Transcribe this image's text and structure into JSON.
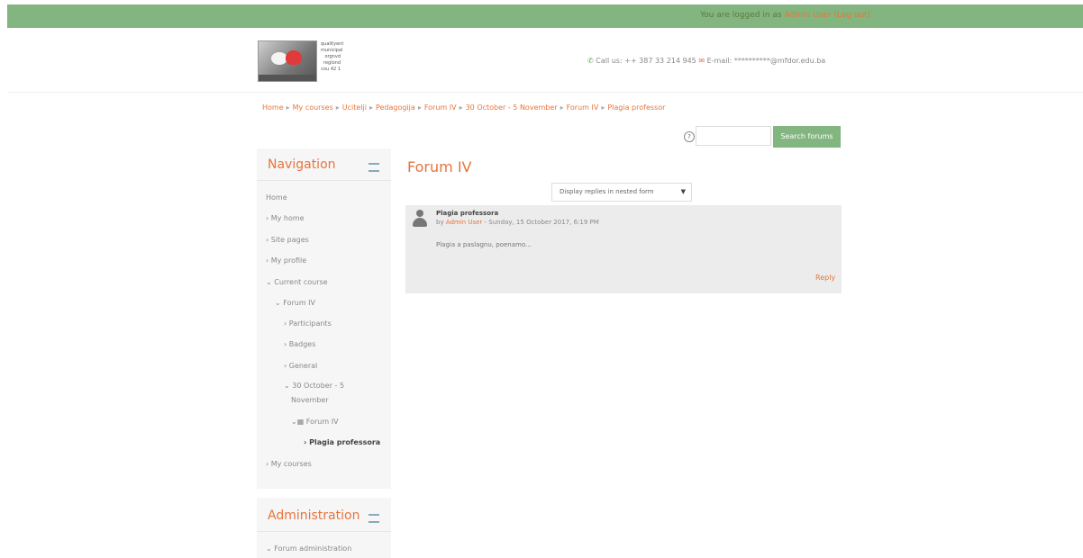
{
  "topbar": {
    "login_prefix": "You are logged in as ",
    "login_link": "Admin User (Log out)"
  },
  "header": {
    "logo_text": [
      "qualityent",
      "municipal",
      "orgnvd",
      "reglond",
      "cou 42 1"
    ],
    "call_label": "Call us: ++ 387 33 214 945",
    "email_label": "E-mail: **********@mfdor.edu.ba"
  },
  "breadcrumb": [
    "Home",
    "My courses",
    "Ucitelji",
    "Pedagogija",
    "Forum IV",
    "30 October - 5 November",
    "Forum IV",
    "Plagia professor"
  ],
  "search": {
    "placeholder": "",
    "button_label": "Search forums",
    "help_glyph": "?"
  },
  "nav_block": {
    "title": "Navigation",
    "items": [
      {
        "label": "Home",
        "active": false
      },
      {
        "label": "› My home",
        "active": false
      },
      {
        "label": "› Site pages",
        "active": false
      },
      {
        "label": "› My profile",
        "active": false
      },
      {
        "label": "⌄ Current course",
        "active": false
      },
      {
        "label": "⌄ Forum IV",
        "active": false
      },
      {
        "label": "› Participants",
        "active": false
      },
      {
        "label": "› Badges",
        "active": false
      },
      {
        "label": "› General",
        "active": false
      },
      {
        "label": "⌄ 30 October - 5",
        "active": false
      },
      {
        "label": "November",
        "active": false
      },
      {
        "label": "⌄▦ Forum IV",
        "active": false
      },
      {
        "label": "› Plagia professora",
        "active": true
      },
      {
        "label": "› My courses",
        "active": false
      }
    ]
  },
  "admin_block": {
    "title": "Administration",
    "items": [
      {
        "label": "⌄ Forum administration"
      }
    ]
  },
  "main": {
    "forum_title": "Forum IV",
    "display_mode": "Display replies in nested form",
    "post": {
      "subject": "Plagia professora",
      "meta_prefix": "by ",
      "author": "Admin User",
      "meta_suffix": " - Sunday, 15 October 2017, 6:19 PM",
      "body": "Plagia a paslagnu, poenamo...",
      "reply": "Reply"
    }
  },
  "colors": {
    "accent": "#e8743b",
    "green": "#82b580",
    "block_bg": "#f6f6f6"
  }
}
